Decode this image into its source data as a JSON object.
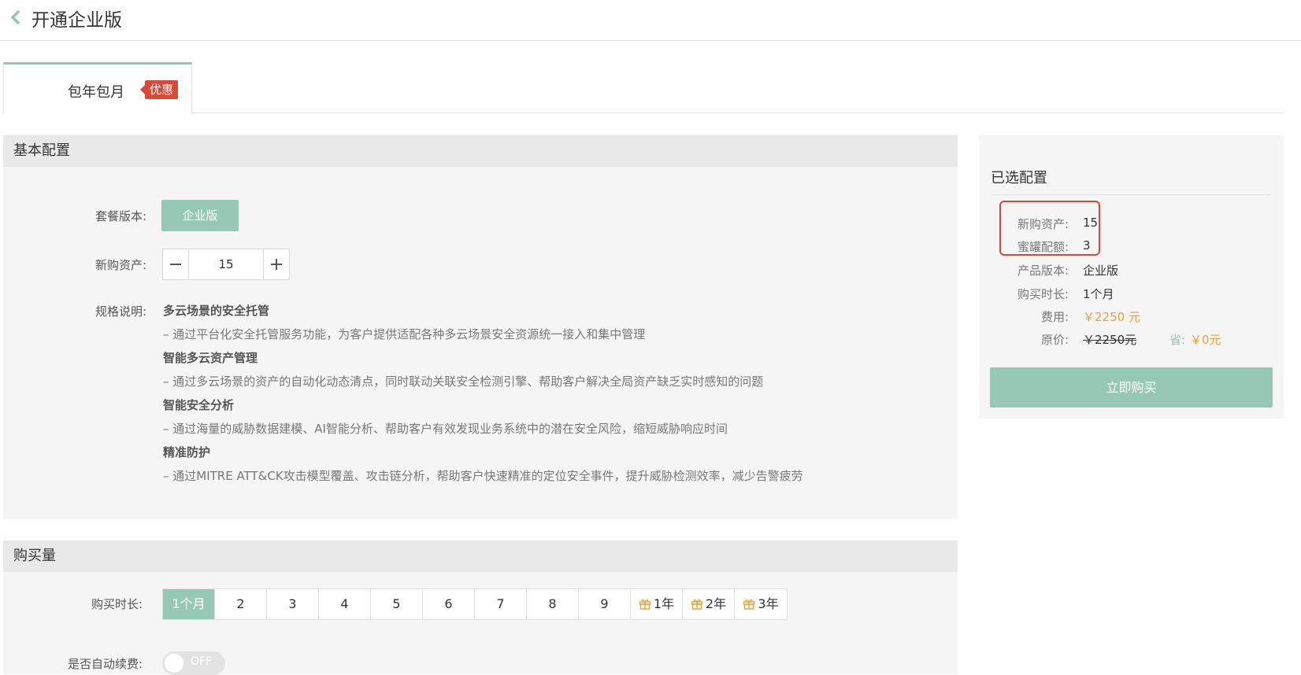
{
  "header": {
    "title": "开通企业版"
  },
  "tabs": [
    {
      "label": "包年包月",
      "badge": "优惠"
    }
  ],
  "basic": {
    "title": "基本配置",
    "edition_label": "套餐版本:",
    "edition_value": "企业版",
    "assets_label": "新购资产:",
    "assets_value": "15",
    "spec_label": "规格说明:",
    "spec": [
      {
        "heading": "多云场景的安全托管",
        "desc": "– 通过平台化安全托管服务功能，为客户提供适配各种多云场景安全资源统一接入和集中管理"
      },
      {
        "heading": "智能多云资产管理",
        "desc": "– 通过多云场景的资产的自动化动态清点，同时联动关联安全检测引擎、帮助客户解决全局资产缺乏实时感知的问题"
      },
      {
        "heading": "智能安全分析",
        "desc": "– 通过海量的威胁数据建模、AI智能分析、帮助客户有效发现业务系统中的潜在安全风险，缩短威胁响应时间"
      },
      {
        "heading": "精准防护",
        "desc": "– 通过MITRE ATT&CK攻击模型覆盖、攻击链分析，帮助客户快速精准的定位安全事件，提升威胁检测效率，减少告警疲劳"
      }
    ]
  },
  "purchase": {
    "title": "购买量",
    "duration_label": "购买时长:",
    "durations": [
      {
        "label": "1个月",
        "active": true,
        "gift": false
      },
      {
        "label": "2",
        "active": false,
        "gift": false
      },
      {
        "label": "3",
        "active": false,
        "gift": false
      },
      {
        "label": "4",
        "active": false,
        "gift": false
      },
      {
        "label": "5",
        "active": false,
        "gift": false
      },
      {
        "label": "6",
        "active": false,
        "gift": false
      },
      {
        "label": "7",
        "active": false,
        "gift": false
      },
      {
        "label": "8",
        "active": false,
        "gift": false
      },
      {
        "label": "9",
        "active": false,
        "gift": false
      },
      {
        "label": "1年",
        "active": false,
        "gift": true
      },
      {
        "label": "2年",
        "active": false,
        "gift": true
      },
      {
        "label": "3年",
        "active": false,
        "gift": true
      }
    ],
    "auto_renew_label": "是否自动续费:",
    "auto_renew_state": "OFF"
  },
  "summary": {
    "title": "已选配置",
    "assets_k": "新购资产:",
    "assets_v": "15",
    "honeypot_k": "蜜罐配额:",
    "honeypot_v": "3",
    "edition_k": "产品版本:",
    "edition_v": "企业版",
    "duration_k": "购买时长:",
    "duration_v": "1个月",
    "fee_k": "费用:",
    "fee_v": "￥2250 元",
    "orig_k": "原价:",
    "orig_v": "￥2250元",
    "save_k": "省:",
    "save_v": "￥0元",
    "buy_label": "立即购买"
  },
  "colors": {
    "accent": "#95c9b6",
    "badge": "#d64a3a",
    "price": "#e6a23c"
  }
}
